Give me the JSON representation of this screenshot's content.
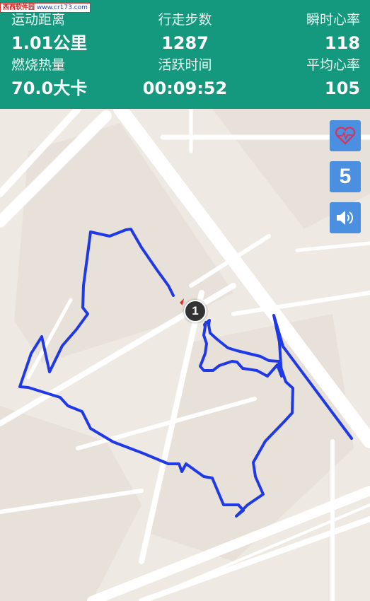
{
  "watermark": {
    "site_name": "西西软件园",
    "url": "www.cr173.com"
  },
  "stats": {
    "distance": {
      "label": "运动距离",
      "value": "1.01公里"
    },
    "steps": {
      "label": "行走步数",
      "value": "1287"
    },
    "heart_rate_now": {
      "label": "瞬时心率",
      "value": "118"
    },
    "calories": {
      "label": "燃烧热量",
      "value": "70.0大卡"
    },
    "active_time": {
      "label": "活跃时间",
      "value": "00:09:52"
    },
    "heart_rate_avg": {
      "label": "平均心率",
      "value": "105"
    }
  },
  "controls": {
    "heart_icon": "heart-rate-icon",
    "voice_interval": "5",
    "sound_icon": "speaker-icon"
  },
  "map": {
    "start_marker": "1",
    "route_color": "#1f39e6",
    "colors": {
      "header": "#14997e",
      "control": "#4a8fe0",
      "land": "#efe9e3",
      "road": "#ffffff"
    }
  }
}
